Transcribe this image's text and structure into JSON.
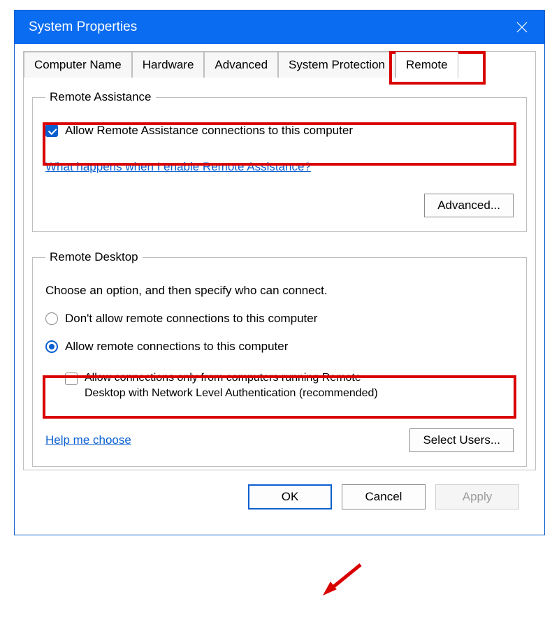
{
  "window": {
    "title": "System Properties"
  },
  "tabs": {
    "items": [
      {
        "label": "Computer Name"
      },
      {
        "label": "Hardware"
      },
      {
        "label": "Advanced"
      },
      {
        "label": "System Protection"
      },
      {
        "label": "Remote",
        "active": true
      }
    ]
  },
  "remote_assistance": {
    "legend": "Remote Assistance",
    "allow_label": "Allow Remote Assistance connections to this computer",
    "allow_checked": true,
    "help_link": "What happens when I enable Remote Assistance?",
    "advanced_button": "Advanced..."
  },
  "remote_desktop": {
    "legend": "Remote Desktop",
    "prompt": "Choose an option, and then specify who can connect.",
    "radio_deny": "Don't allow remote connections to this computer",
    "radio_allow": "Allow remote connections to this computer",
    "selected": "allow",
    "nl_auth_label_line1": "Allow connections only from computers running Remote",
    "nl_auth_label_line2": "Desktop with Network Level Authentication (recommended)",
    "nl_auth_checked": false,
    "help_link": "Help me choose",
    "select_users_button": "Select Users..."
  },
  "footer": {
    "ok": "OK",
    "cancel": "Cancel",
    "apply": "Apply"
  }
}
